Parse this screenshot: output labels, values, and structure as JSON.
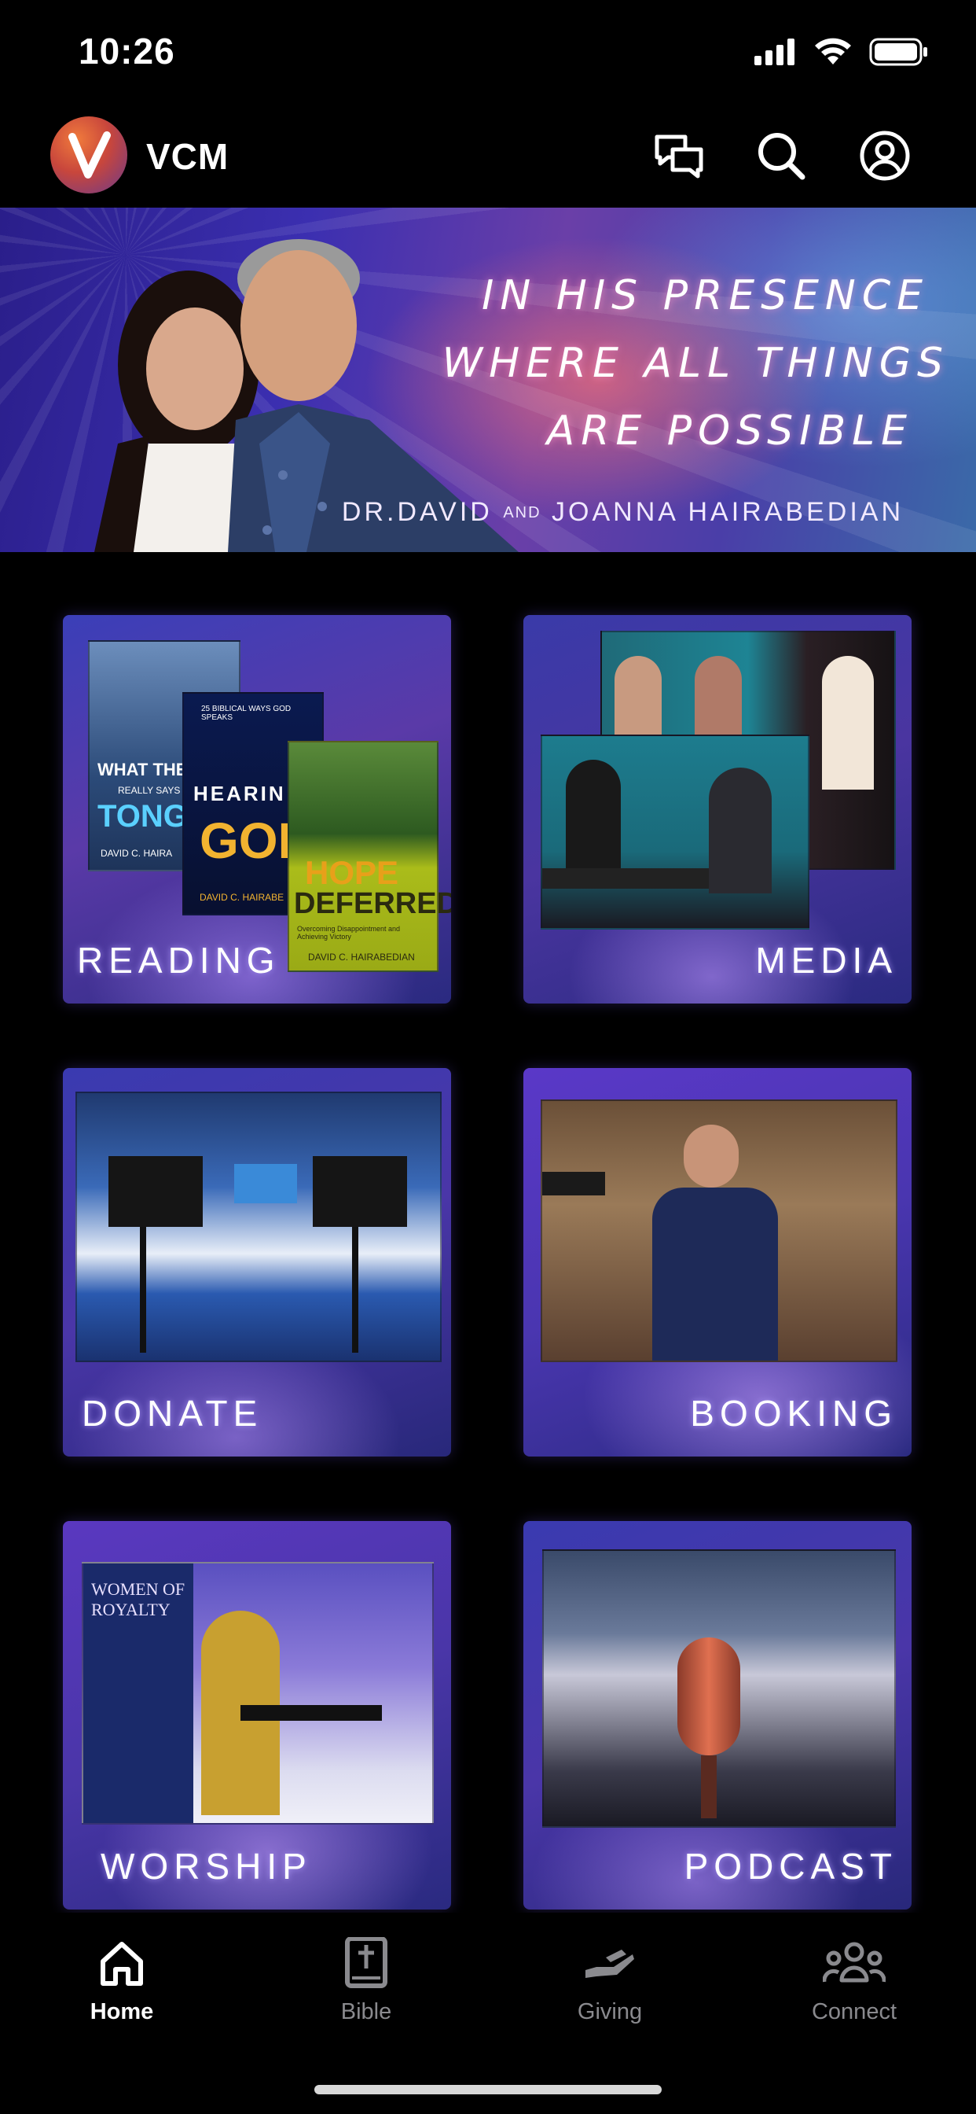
{
  "status_bar": {
    "time": "10:26",
    "icons": [
      "cellular-signal-icon",
      "wifi-icon",
      "battery-icon"
    ]
  },
  "header": {
    "brand": "VCM",
    "logo_letter": "V",
    "actions": [
      "chat-icon",
      "search-icon",
      "account-icon"
    ]
  },
  "hero": {
    "line1": "IN HIS PRESENCE",
    "line2": "WHERE ALL THINGS",
    "line3": "ARE POSSIBLE",
    "byline_a": "DR.DAVID",
    "byline_and": "AND",
    "byline_b": "JOANNA HAIRABEDIAN"
  },
  "tiles": [
    {
      "label": "READING",
      "books": [
        {
          "title": "WHAT THE",
          "subtitle": "REALLY SAYS A",
          "word": "TONGU",
          "author": "DAVID C. HAIRA"
        },
        {
          "title": "25 BIBLICAL WAYS GOD SPEAKS",
          "word1": "HEARIN",
          "word2": "GOD",
          "author": "DAVID C. HAIRABE"
        },
        {
          "word1": "HOPE",
          "word2": "DEFERRED",
          "subtitle": "Overcoming Disappointment and Achieving Victory",
          "author": "DAVID C. HAIRABEDIAN"
        }
      ]
    },
    {
      "label": "MEDIA"
    },
    {
      "label": "DONATE"
    },
    {
      "label": "BOOKING"
    },
    {
      "label": "WORSHIP",
      "sign": "WOMEN OF ROYALTY"
    },
    {
      "label": "PODCAST"
    }
  ],
  "tabbar": [
    {
      "label": "Home",
      "icon": "home-icon",
      "active": true
    },
    {
      "label": "Bible",
      "icon": "bible-icon",
      "active": false
    },
    {
      "label": "Giving",
      "icon": "giving-hand-icon",
      "active": false
    },
    {
      "label": "Connect",
      "icon": "group-icon",
      "active": false
    }
  ],
  "colors": {
    "background": "#000000",
    "tab_active": "#ffffff",
    "tab_inactive": "#8a8a8e",
    "tile_glow": "#7a5aff"
  }
}
